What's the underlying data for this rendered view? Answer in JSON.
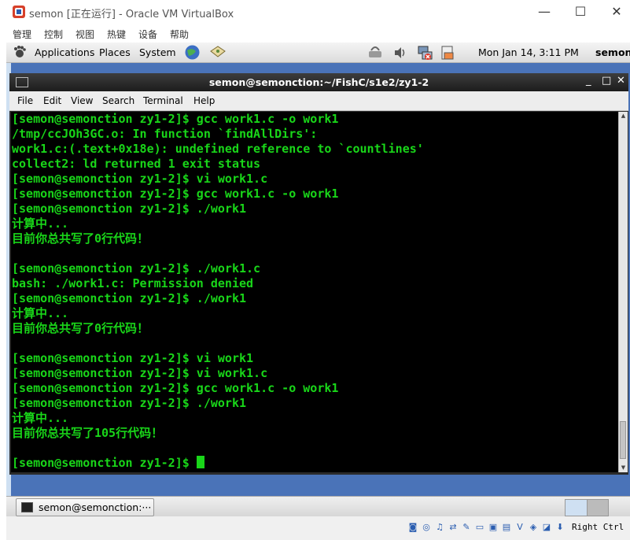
{
  "host": {
    "title": "semon [正在运行] - Oracle VM VirtualBox",
    "minimize": "—",
    "maximize": "☐",
    "close": "✕",
    "menu": [
      "管理",
      "控制",
      "视图",
      "热键",
      "设备",
      "帮助"
    ]
  },
  "gnome_panel": {
    "applications": "Applications",
    "places": "Places",
    "system": "System",
    "clock": "Mon Jan 14,  3:11 PM",
    "user": "semon"
  },
  "terminal": {
    "title": "semon@semonction:~/FishC/s1e2/zy1-2",
    "buttons": [
      "_",
      "□",
      "✕"
    ],
    "menu": [
      "File",
      "Edit",
      "View",
      "Search",
      "Terminal",
      "Help"
    ],
    "lines": [
      "[semon@semonction zy1-2]$ gcc work1.c -o work1",
      "/tmp/ccJOh3GC.o: In function `findAllDirs':",
      "work1.c:(.text+0x18e): undefined reference to `countlines'",
      "collect2: ld returned 1 exit status",
      "[semon@semonction zy1-2]$ vi work1.c",
      "[semon@semonction zy1-2]$ gcc work1.c -o work1",
      "[semon@semonction zy1-2]$ ./work1",
      "计算中...",
      "目前你总共写了0行代码！",
      "",
      "[semon@semonction zy1-2]$ ./work1.c",
      "bash: ./work1.c: Permission denied",
      "[semon@semonction zy1-2]$ ./work1",
      "计算中...",
      "目前你总共写了0行代码！",
      "",
      "[semon@semonction zy1-2]$ vi work1",
      "[semon@semonction zy1-2]$ vi work1.c",
      "[semon@semonction zy1-2]$ gcc work1.c -o work1",
      "[semon@semonction zy1-2]$ ./work1",
      "计算中...",
      "目前你总共写了105行代码！",
      ""
    ],
    "prompt": "[semon@semonction zy1-2]$ "
  },
  "taskbar": {
    "terminal_button": "semon@semonction:···"
  },
  "vbox_status": {
    "host_key": "Right Ctrl"
  },
  "colors": {
    "terminal_fg": "#19d619",
    "terminal_bg": "#000000",
    "desktop": "#4a73b8"
  }
}
